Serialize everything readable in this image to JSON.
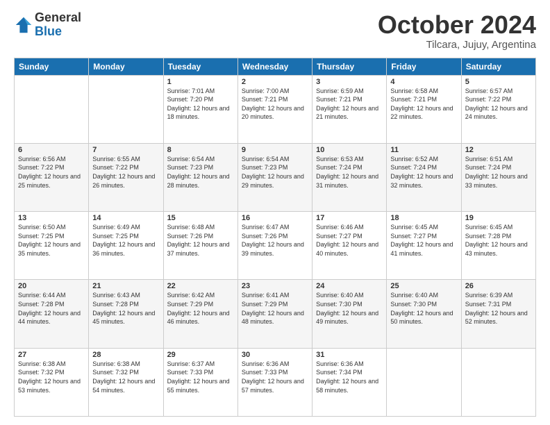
{
  "header": {
    "logo": {
      "general": "General",
      "blue": "Blue"
    },
    "title": "October 2024",
    "location": "Tilcara, Jujuy, Argentina"
  },
  "days_of_week": [
    "Sunday",
    "Monday",
    "Tuesday",
    "Wednesday",
    "Thursday",
    "Friday",
    "Saturday"
  ],
  "weeks": [
    [
      {
        "day": "",
        "info": ""
      },
      {
        "day": "",
        "info": ""
      },
      {
        "day": "1",
        "info": "Sunrise: 7:01 AM\nSunset: 7:20 PM\nDaylight: 12 hours and 18 minutes."
      },
      {
        "day": "2",
        "info": "Sunrise: 7:00 AM\nSunset: 7:21 PM\nDaylight: 12 hours and 20 minutes."
      },
      {
        "day": "3",
        "info": "Sunrise: 6:59 AM\nSunset: 7:21 PM\nDaylight: 12 hours and 21 minutes."
      },
      {
        "day": "4",
        "info": "Sunrise: 6:58 AM\nSunset: 7:21 PM\nDaylight: 12 hours and 22 minutes."
      },
      {
        "day": "5",
        "info": "Sunrise: 6:57 AM\nSunset: 7:22 PM\nDaylight: 12 hours and 24 minutes."
      }
    ],
    [
      {
        "day": "6",
        "info": "Sunrise: 6:56 AM\nSunset: 7:22 PM\nDaylight: 12 hours and 25 minutes."
      },
      {
        "day": "7",
        "info": "Sunrise: 6:55 AM\nSunset: 7:22 PM\nDaylight: 12 hours and 26 minutes."
      },
      {
        "day": "8",
        "info": "Sunrise: 6:54 AM\nSunset: 7:23 PM\nDaylight: 12 hours and 28 minutes."
      },
      {
        "day": "9",
        "info": "Sunrise: 6:54 AM\nSunset: 7:23 PM\nDaylight: 12 hours and 29 minutes."
      },
      {
        "day": "10",
        "info": "Sunrise: 6:53 AM\nSunset: 7:24 PM\nDaylight: 12 hours and 31 minutes."
      },
      {
        "day": "11",
        "info": "Sunrise: 6:52 AM\nSunset: 7:24 PM\nDaylight: 12 hours and 32 minutes."
      },
      {
        "day": "12",
        "info": "Sunrise: 6:51 AM\nSunset: 7:24 PM\nDaylight: 12 hours and 33 minutes."
      }
    ],
    [
      {
        "day": "13",
        "info": "Sunrise: 6:50 AM\nSunset: 7:25 PM\nDaylight: 12 hours and 35 minutes."
      },
      {
        "day": "14",
        "info": "Sunrise: 6:49 AM\nSunset: 7:25 PM\nDaylight: 12 hours and 36 minutes."
      },
      {
        "day": "15",
        "info": "Sunrise: 6:48 AM\nSunset: 7:26 PM\nDaylight: 12 hours and 37 minutes."
      },
      {
        "day": "16",
        "info": "Sunrise: 6:47 AM\nSunset: 7:26 PM\nDaylight: 12 hours and 39 minutes."
      },
      {
        "day": "17",
        "info": "Sunrise: 6:46 AM\nSunset: 7:27 PM\nDaylight: 12 hours and 40 minutes."
      },
      {
        "day": "18",
        "info": "Sunrise: 6:45 AM\nSunset: 7:27 PM\nDaylight: 12 hours and 41 minutes."
      },
      {
        "day": "19",
        "info": "Sunrise: 6:45 AM\nSunset: 7:28 PM\nDaylight: 12 hours and 43 minutes."
      }
    ],
    [
      {
        "day": "20",
        "info": "Sunrise: 6:44 AM\nSunset: 7:28 PM\nDaylight: 12 hours and 44 minutes."
      },
      {
        "day": "21",
        "info": "Sunrise: 6:43 AM\nSunset: 7:28 PM\nDaylight: 12 hours and 45 minutes."
      },
      {
        "day": "22",
        "info": "Sunrise: 6:42 AM\nSunset: 7:29 PM\nDaylight: 12 hours and 46 minutes."
      },
      {
        "day": "23",
        "info": "Sunrise: 6:41 AM\nSunset: 7:29 PM\nDaylight: 12 hours and 48 minutes."
      },
      {
        "day": "24",
        "info": "Sunrise: 6:40 AM\nSunset: 7:30 PM\nDaylight: 12 hours and 49 minutes."
      },
      {
        "day": "25",
        "info": "Sunrise: 6:40 AM\nSunset: 7:30 PM\nDaylight: 12 hours and 50 minutes."
      },
      {
        "day": "26",
        "info": "Sunrise: 6:39 AM\nSunset: 7:31 PM\nDaylight: 12 hours and 52 minutes."
      }
    ],
    [
      {
        "day": "27",
        "info": "Sunrise: 6:38 AM\nSunset: 7:32 PM\nDaylight: 12 hours and 53 minutes."
      },
      {
        "day": "28",
        "info": "Sunrise: 6:38 AM\nSunset: 7:32 PM\nDaylight: 12 hours and 54 minutes."
      },
      {
        "day": "29",
        "info": "Sunrise: 6:37 AM\nSunset: 7:33 PM\nDaylight: 12 hours and 55 minutes."
      },
      {
        "day": "30",
        "info": "Sunrise: 6:36 AM\nSunset: 7:33 PM\nDaylight: 12 hours and 57 minutes."
      },
      {
        "day": "31",
        "info": "Sunrise: 6:36 AM\nSunset: 7:34 PM\nDaylight: 12 hours and 58 minutes."
      },
      {
        "day": "",
        "info": ""
      },
      {
        "day": "",
        "info": ""
      }
    ]
  ]
}
